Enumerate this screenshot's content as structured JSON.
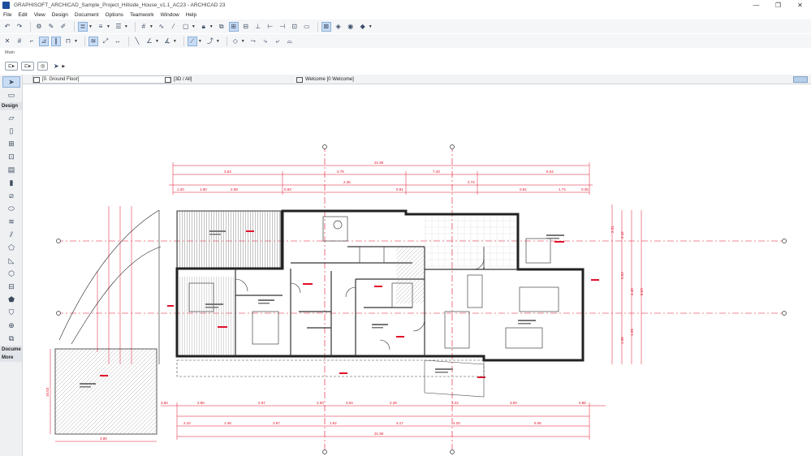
{
  "window": {
    "title": "GRAPHISOFT_ARCHICAD_Sample_Project_Hillside_House_v1.1_AC23 - ARCHICAD 23",
    "controls": [
      "—",
      "❐",
      "✕"
    ]
  },
  "menu": [
    "File",
    "Edit",
    "View",
    "Design",
    "Document",
    "Options",
    "Teamwork",
    "Window",
    "Help"
  ],
  "toolbar_main_label": "Main",
  "toolbox": {
    "design_label": "Design",
    "document_label": "Docume",
    "more_label": "More"
  },
  "tabs": [
    {
      "label": "[0. Ground Floor]",
      "active": true
    },
    {
      "label": "[3D / All]",
      "active": false
    },
    {
      "label": "Welcome [0 Welcome]",
      "active": false
    }
  ],
  "plan_labels": {
    "overall_top": "21.90",
    "overall_bottom": "21.90",
    "row_top": [
      "3.63",
      "4.75",
      "7.43",
      "6.04"
    ],
    "row_mid": [
      "1.20",
      "1.00",
      "2.08",
      "0.93",
      "2.36",
      "0.91",
      "2.74",
      "0.91",
      "1.74",
      "0.35"
    ],
    "row_bottom1": [
      "3.60",
      "2.80",
      "2.97",
      "2.00",
      "3.04",
      "2.39",
      "3.22",
      "3.00",
      "0.88"
    ],
    "row_bottom2": [
      "2.10",
      "1.48",
      "2.67",
      "1.62",
      "3.17",
      "2.20",
      "6.06"
    ],
    "left_pad": "10.53",
    "pad_width": "3.80",
    "right_dims": [
      "2.31",
      "2.42",
      "3.53",
      "4.40",
      "1.26",
      "1.56",
      "8.63"
    ]
  },
  "colors": {
    "dimension": "#e0102a",
    "wall": "#2a2a2a",
    "accent": "#c9dcf3"
  }
}
